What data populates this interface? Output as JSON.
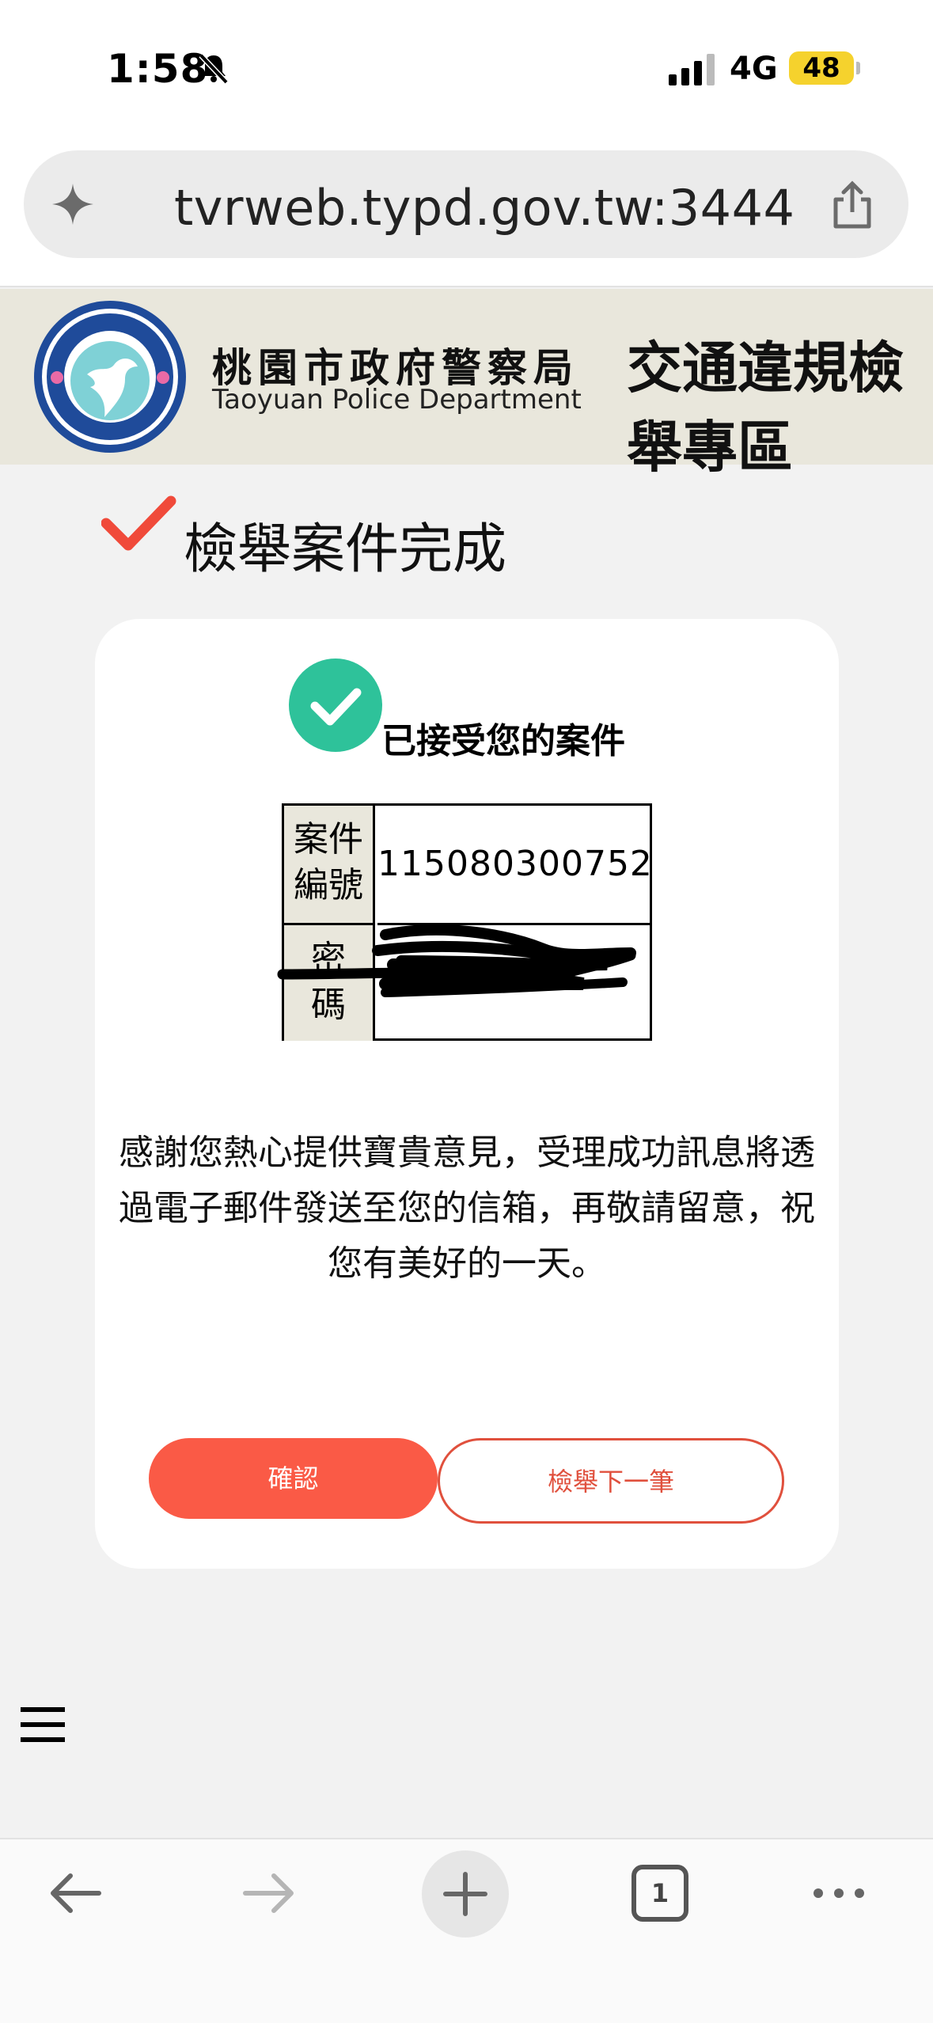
{
  "status_bar": {
    "time": "1:58",
    "network": "4G",
    "battery": "48"
  },
  "browser": {
    "url": "tvrweb.typd.gov.tw:3444",
    "tab_count": "1"
  },
  "header": {
    "dept_name_zh": "桃園市政府警察局",
    "dept_name_en": "Taoyuan Police Department",
    "section_title": "交通違規檢舉專區",
    "logo_text": "桃園市政府警察局 TAOYUAN POLICE DEPARTMENT"
  },
  "page": {
    "title": "檢舉案件完成",
    "status_message": "已接受您的案件",
    "case_table": {
      "case_number_label": "案件編號",
      "case_number_value": "115080300752",
      "password_label": "密碼",
      "password_value": ""
    },
    "thanks_message": "感謝您熱心提供寶貴意見，受理成功訊息將透過電子郵件發送至您的信箱，再敬請留意，祝您有美好的一天。",
    "confirm_button": "確認",
    "next_button": "檢舉下一筆"
  },
  "colors": {
    "accent": "#fa5a46",
    "success": "#2ec29a",
    "header_band": "#e9e7dc"
  }
}
